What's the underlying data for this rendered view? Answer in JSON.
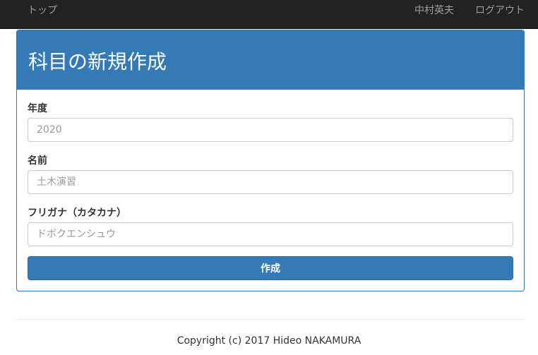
{
  "navbar": {
    "home_label": "トップ",
    "user_label": "中村英夫",
    "logout_label": "ログアウト"
  },
  "panel": {
    "title": "科目の新規作成"
  },
  "form": {
    "year": {
      "label": "年度",
      "placeholder": "2020"
    },
    "name": {
      "label": "名前",
      "placeholder": "土木演習"
    },
    "furigana": {
      "label": "フリガナ（カタカナ）",
      "placeholder": "ドボクエンシュウ"
    },
    "submit_label": "作成"
  },
  "footer": {
    "copyright": "Copyright (c) 2017 Hideo NAKAMURA"
  },
  "colors": {
    "navbar_bg": "#222222",
    "primary": "#337ab7"
  }
}
